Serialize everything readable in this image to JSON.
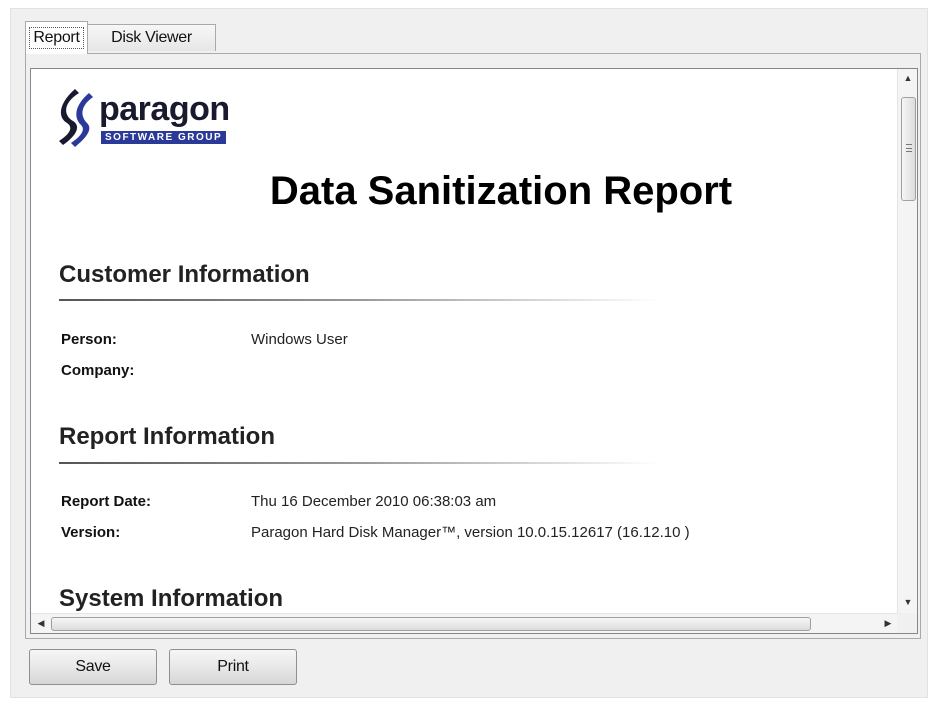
{
  "tabs": [
    {
      "label": "Report",
      "active": true
    },
    {
      "label": "Disk Viewer",
      "active": false
    }
  ],
  "report": {
    "logo": {
      "wordmark": "paragon",
      "tagline": "SOFTWARE GROUP"
    },
    "title": "Data Sanitization Report",
    "sections": {
      "customer": {
        "heading": "Customer Information",
        "person_label": "Person:",
        "person_value": "Windows User",
        "company_label": "Company:",
        "company_value": ""
      },
      "report_info": {
        "heading": "Report Information",
        "date_label": "Report Date:",
        "date_value": "Thu 16 December 2010 06:38:03 am",
        "version_label": "Version:",
        "version_value": "Paragon Hard Disk Manager™, version 10.0.15.12617 (16.12.10 )"
      },
      "system": {
        "heading": "System Information"
      }
    }
  },
  "buttons": {
    "save": "Save",
    "print": "Print"
  },
  "colors": {
    "logo_band": "#2b3a98",
    "logo_mark": "#1a1a2e"
  }
}
